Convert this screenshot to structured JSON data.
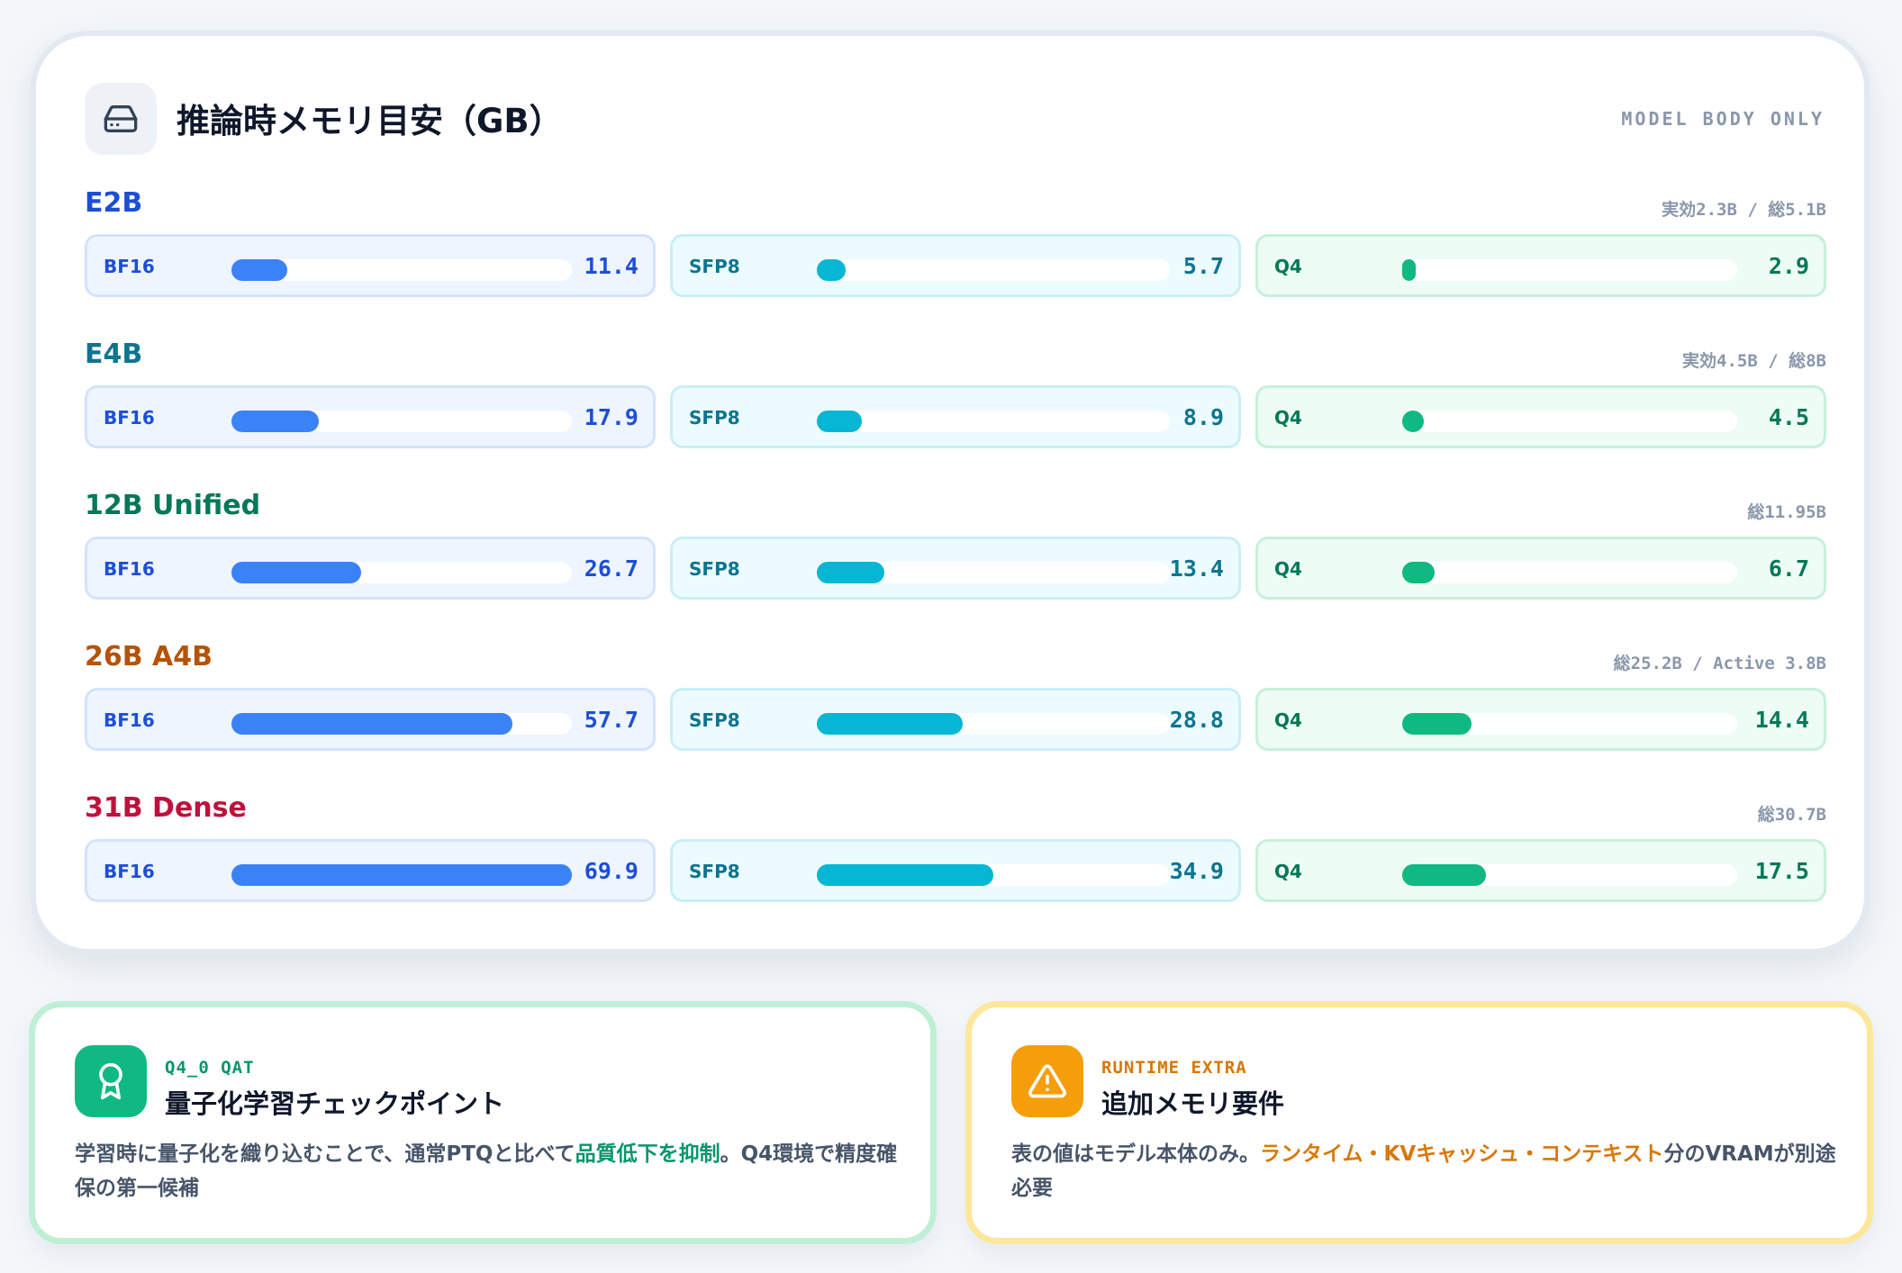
{
  "header": {
    "icon": "hard-drive-icon",
    "title": "推論時メモリ目安（GB）",
    "tag": "MODEL BODY ONLY"
  },
  "quant_labels": {
    "bf16": "BF16",
    "sfp8": "SFP8",
    "q4": "Q4"
  },
  "scale_max": 69.9,
  "models": [
    {
      "name": "E2B",
      "color": "#1d4ed8",
      "meta": "実効2.3B / 総5.1B",
      "bf16": {
        "label": "11.4",
        "value": 11.4
      },
      "sfp8": {
        "label": "5.7",
        "value": 5.7
      },
      "q4": {
        "label": "2.9",
        "value": 2.9
      }
    },
    {
      "name": "E4B",
      "color": "#0e7490",
      "meta": "実効4.5B / 総8B",
      "bf16": {
        "label": "17.9",
        "value": 17.9
      },
      "sfp8": {
        "label": "8.9",
        "value": 8.9
      },
      "q4": {
        "label": "4.5",
        "value": 4.5
      }
    },
    {
      "name": "12B Unified",
      "color": "#047857",
      "meta": "総11.95B",
      "bf16": {
        "label": "26.7",
        "value": 26.7
      },
      "sfp8": {
        "label": "13.4",
        "value": 13.4
      },
      "q4": {
        "label": "6.7",
        "value": 6.7
      }
    },
    {
      "name": "26B A4B",
      "color": "#b45309",
      "meta": "総25.2B / Active 3.8B",
      "bf16": {
        "label": "57.7",
        "value": 57.7
      },
      "sfp8": {
        "label": "28.8",
        "value": 28.8
      },
      "q4": {
        "label": "14.4",
        "value": 14.4
      }
    },
    {
      "name": "31B Dense",
      "color": "#be123c",
      "meta": "総30.7B",
      "bf16": {
        "label": "69.9",
        "value": 69.9
      },
      "sfp8": {
        "label": "34.9",
        "value": 34.9
      },
      "q4": {
        "label": "17.5",
        "value": 17.5
      }
    }
  ],
  "info_qat": {
    "icon": "award-icon",
    "color": "#10b981",
    "kicker": "Q4_0 QAT",
    "title": "量子化学習チェックポイント",
    "body_before": "学習時に量子化を織り込むことで、通常PTQと比べて",
    "body_highlight": "品質低下を抑制",
    "body_after": "。Q4環境で精度確保の第一候補"
  },
  "info_runtime": {
    "icon": "warning-icon",
    "color": "#f59e0b",
    "kicker": "RUNTIME EXTRA",
    "title": "追加メモリ要件",
    "body_before": "表の値はモデル本体のみ。",
    "body_highlight": "ランタイム・KVキャッシュ・コンテキスト",
    "body_after": "分のVRAMが別途必要"
  }
}
